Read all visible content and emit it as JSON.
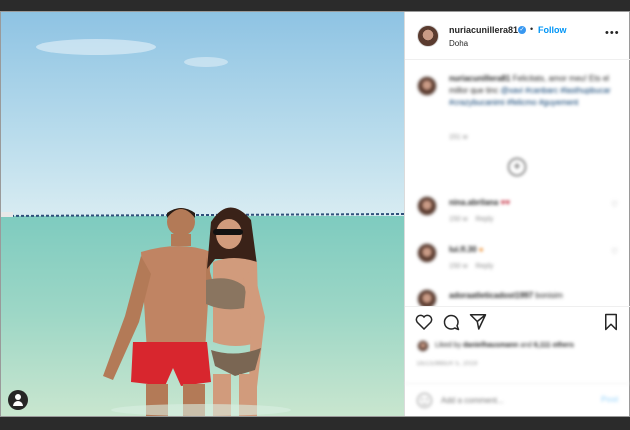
{
  "post": {
    "username": "nuriacunillera81",
    "verified_mark": "✓",
    "separator": "•",
    "follow_label": "Follow",
    "location": "Doha",
    "more_label": "•••"
  },
  "caption": {
    "username": "nuriacunillera81",
    "text": "Felicitats, amor meu! Ets el millor que tinc",
    "hashtags": "@xavi #canbarc #lasthupbucar #crazybucanimi #felicmo #guyement",
    "time": "151 w",
    "load_more": "+"
  },
  "comments": [
    {
      "username": "nina.abrilana",
      "text": "♥♥",
      "time": "150 w",
      "reply": "Reply"
    },
    {
      "username": "lui.fl.30",
      "text": "●",
      "time": "150 w",
      "reply": "Reply"
    },
    {
      "username": "adoraatleticadost1997",
      "text": "bonisim",
      "time": "",
      "reply": ""
    }
  ],
  "likes": {
    "prefix": "Liked by",
    "user": "danielhausmann",
    "connector": "and",
    "count": "6,111 others"
  },
  "date": "DECEMBER 5, 2019",
  "comment_box": {
    "placeholder": "Add a comment...",
    "post_label": "Post"
  },
  "icons": [
    "heart-icon",
    "comment-icon",
    "share-icon",
    "bookmark-icon",
    "emoji-icon",
    "user-tag-icon",
    "load-more-icon",
    "more-options-icon",
    "verified-badge-icon"
  ],
  "colors": {
    "link": "#0095f6",
    "text": "#262626",
    "muted": "#8e8e8e",
    "post_disabled": "#b2dffc"
  }
}
